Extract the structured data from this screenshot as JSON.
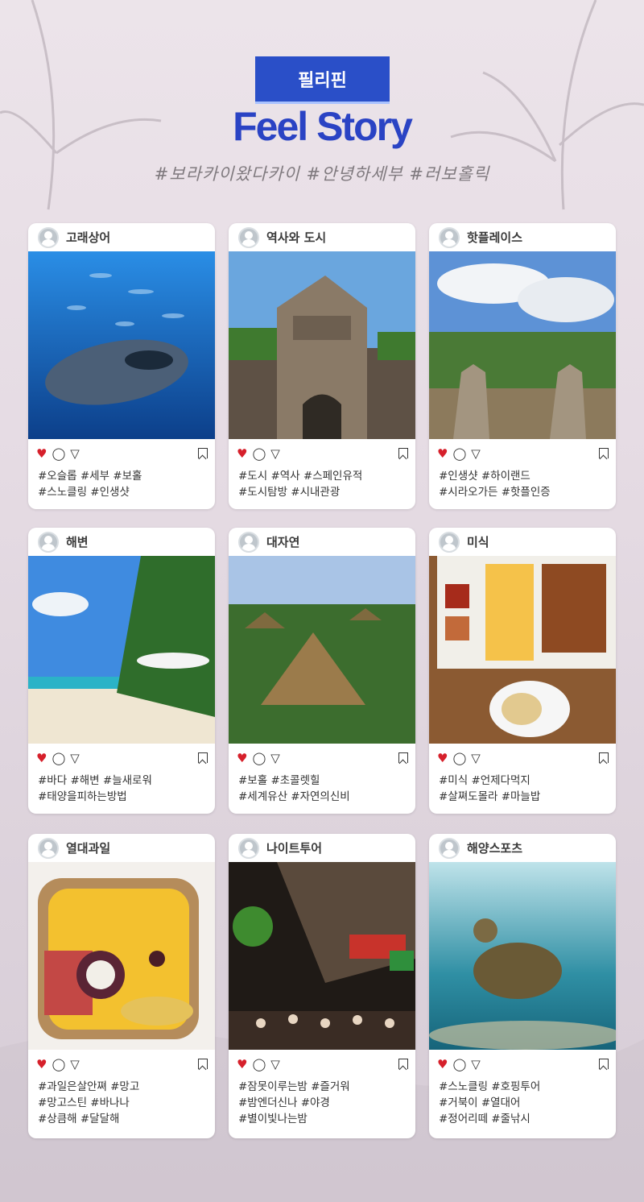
{
  "header": {
    "badge": "필리핀",
    "title": "Feel Story",
    "hashtags": "#보라카이왔다카이 #안녕하세부 #러보홀릭"
  },
  "colors": {
    "brand_blue": "#2a4fc8",
    "heart_red": "#d6202b"
  },
  "cards": [
    {
      "title": "고래상어",
      "tags": [
        "#오슬롭 #세부 #보홀",
        "#스노클링 #인생샷"
      ]
    },
    {
      "title": "역사와 도시",
      "tags": [
        "#도시 #역사 #스페인유적",
        "#도시탐방 #시내관광"
      ]
    },
    {
      "title": "핫플레이스",
      "tags": [
        "#인생샷 #하이랜드",
        "#시라오가든 #핫플인증"
      ]
    },
    {
      "title": "해변",
      "tags": [
        "#바다 #해변 #늘새로워",
        "#태양을피하는방법"
      ]
    },
    {
      "title": "대자연",
      "tags": [
        "#보홀 #초콜렛힐",
        "#세계유산 #자연의신비"
      ]
    },
    {
      "title": "미식",
      "tags": [
        "#미식 #언제다먹지",
        "#살쪄도몰라 #마늘밥"
      ]
    },
    {
      "title": "열대과일",
      "tags": [
        "#과일은살안쪄 #망고",
        "#망고스틴 #바나나",
        "#상큼해 #달달해"
      ]
    },
    {
      "title": "나이트투어",
      "tags": [
        "#잠못이루는밤 #즐거워",
        "#밤엔더신나 #야경",
        "#별이빛나는밤"
      ]
    },
    {
      "title": "해양스포츠",
      "tags": [
        "#스노클링 #호핑투어",
        "#거북이 #열대어",
        "#정어리떼 #줄낚시"
      ]
    }
  ]
}
